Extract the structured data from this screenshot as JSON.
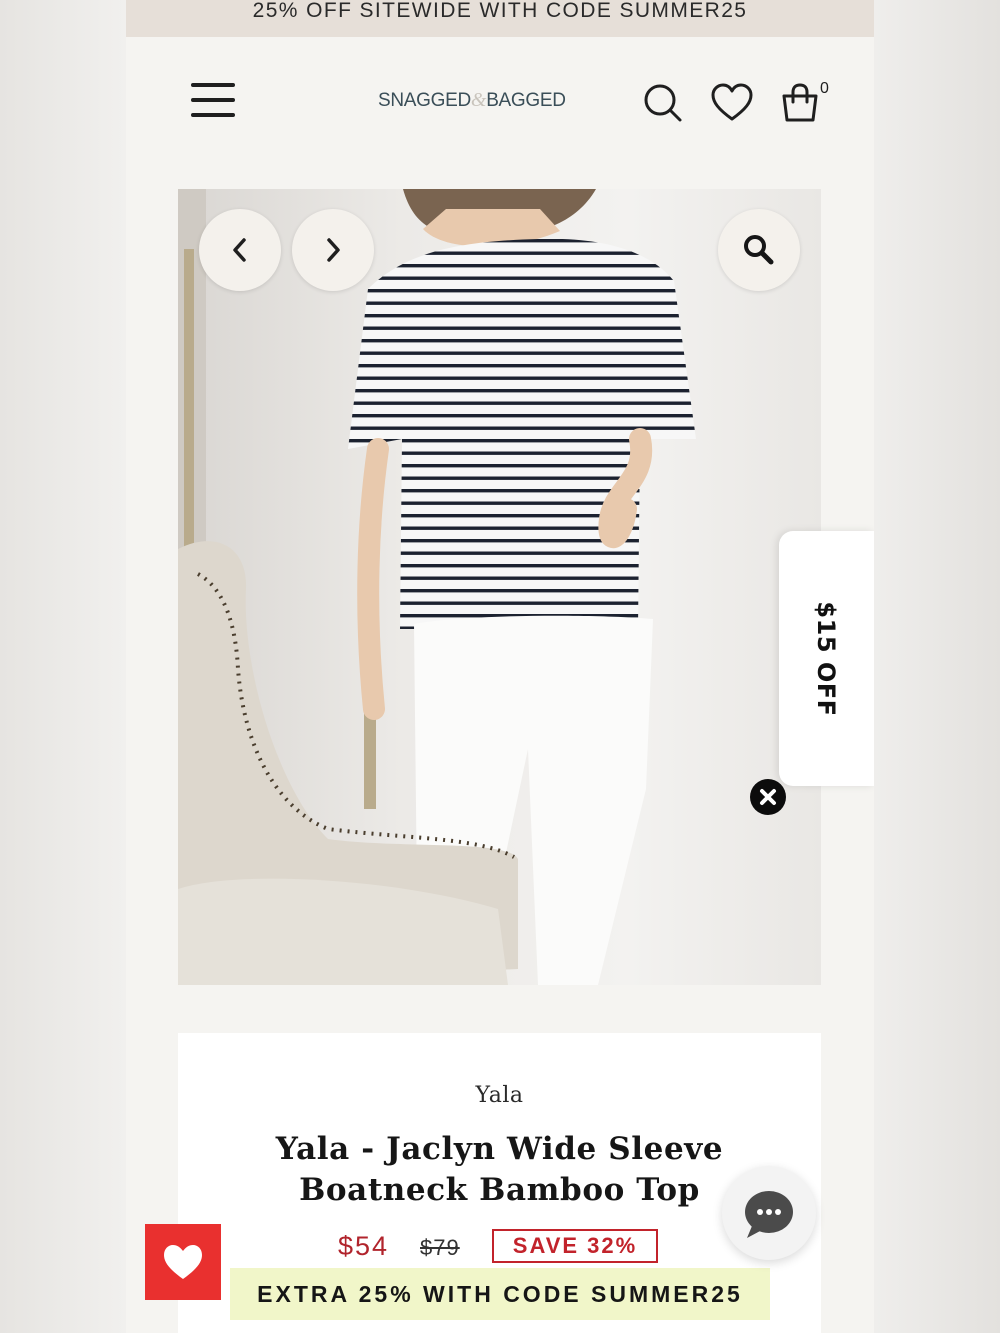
{
  "promo": {
    "text": "25% OFF SITEWIDE WITH CODE SUMMER25"
  },
  "header": {
    "logo_left": "SNAGGED",
    "logo_amp": "&",
    "logo_right": "BAGGED",
    "cart_count": "0",
    "icons": [
      "menu-icon",
      "search-icon",
      "heart-icon",
      "shopping-bag-icon"
    ]
  },
  "gallery": {
    "icons": [
      "chevron-left-icon",
      "chevron-right-icon",
      "zoom-icon"
    ]
  },
  "discount_tab": {
    "label": "$15 OFF"
  },
  "product": {
    "brand": "Yala",
    "title_line1": "Yala - Jaclyn Wide Sleeve",
    "title_line2": "Boatneck Bamboo Top",
    "price": "$54",
    "original_price": "$79",
    "save_label": "SAVE 32%",
    "extra_offer": "EXTRA 25% WITH CODE SUMMER25"
  },
  "colors": {
    "sale_red": "#b1242c",
    "badge_red": "#c2232b",
    "wishlist_red": "#e9302f",
    "promo_bg": "#e6dfd8",
    "extra_offer_bg": "#f1f6c9",
    "logo_color": "#3a4e58"
  }
}
